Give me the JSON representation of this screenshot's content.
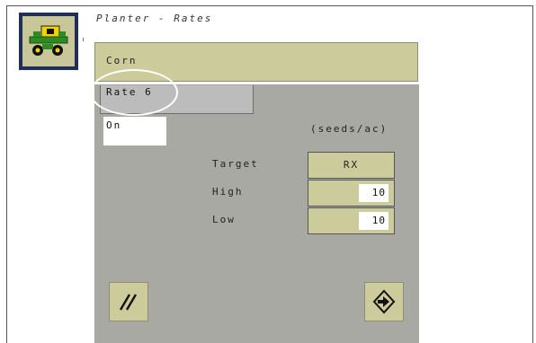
{
  "screen": {
    "title": "Planter - Rates"
  },
  "crop": {
    "label": "Corn"
  },
  "rate_tab": {
    "label": "Rate 6"
  },
  "status": {
    "value": "On"
  },
  "units": {
    "label": "(seeds/ac)"
  },
  "rows": [
    {
      "label": "Target",
      "value": "RX"
    },
    {
      "label": "High",
      "value": "10"
    },
    {
      "label": "Low",
      "value": "10"
    }
  ],
  "icons": {
    "machine": "planter-icon",
    "edit": "edit-slashes-icon",
    "next": "enter-arrow-icon"
  },
  "colors": {
    "panel": "#a9a9a3",
    "button": "#cccb9c",
    "machine_border": "#1f2f5a"
  }
}
